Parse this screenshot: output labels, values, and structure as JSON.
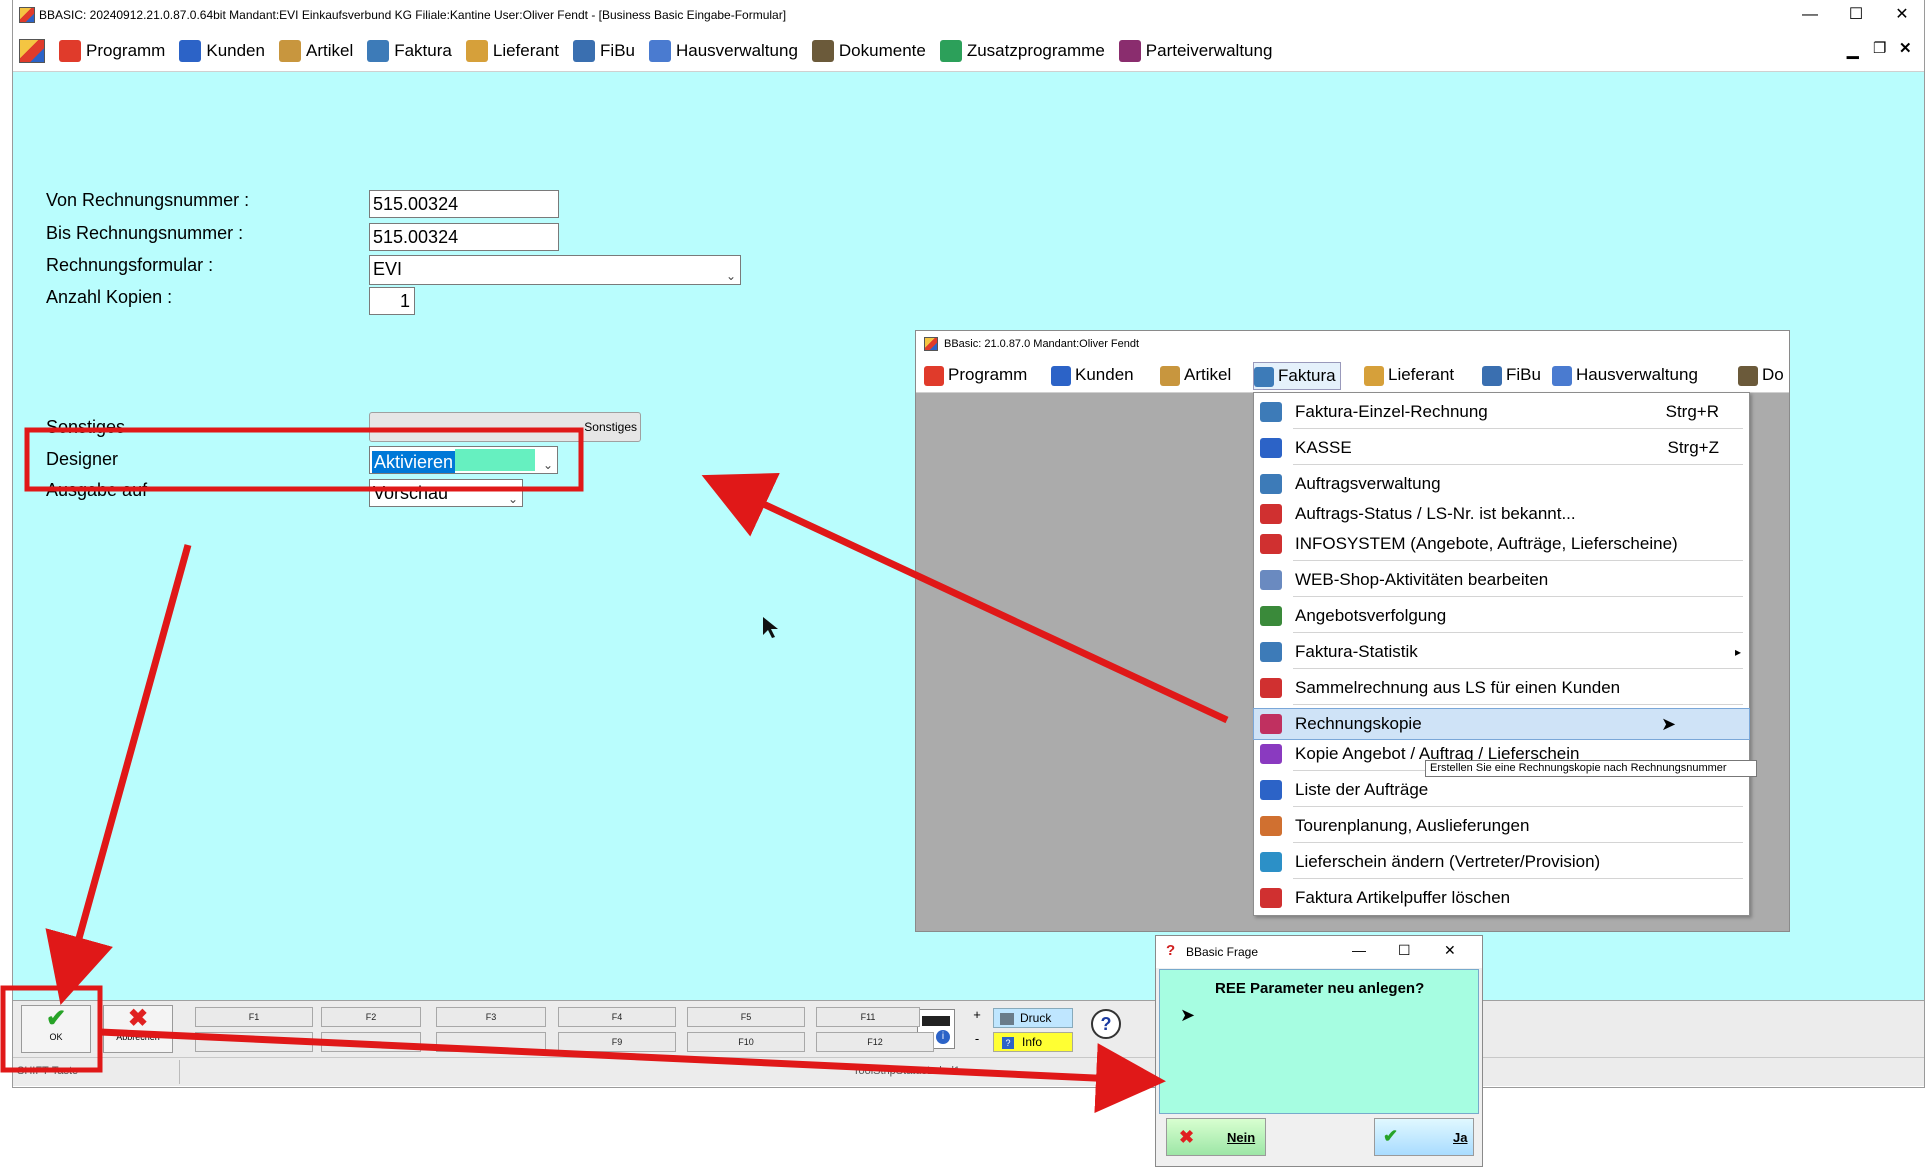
{
  "main": {
    "title": "BBASIC: 20240912.21.0.87.0.64bit Mandant:EVI Einkaufsverbund KG Filiale:Kantine User:Oliver Fendt - [Business Basic Eingabe-Formular]",
    "window_controls": {
      "minimize": "—",
      "maximize": "☐",
      "close": "✕"
    },
    "mdi_controls": {
      "minimize": "▁",
      "restore": "❐",
      "close": "✕"
    },
    "menu": [
      {
        "label": "Programm",
        "icon": "program-icon",
        "color": "#e03b2b"
      },
      {
        "label": "Kunden",
        "icon": "customers-icon",
        "color": "#2c63c7"
      },
      {
        "label": "Artikel",
        "icon": "article-box-icon",
        "color": "#c8963e"
      },
      {
        "label": "Faktura",
        "icon": "faktura-icon",
        "color": "#3d7bb8"
      },
      {
        "label": "Lieferant",
        "icon": "supplier-icon",
        "color": "#d6a03a"
      },
      {
        "label": "FiBu",
        "icon": "fibu-icon",
        "color": "#3a6fb0"
      },
      {
        "label": "Hausverwaltung",
        "icon": "house-icon",
        "color": "#4a7bd0"
      },
      {
        "label": "Dokumente",
        "icon": "documents-icon",
        "color": "#6b5a3a"
      },
      {
        "label": "Zusatzprogramme",
        "icon": "addons-icon",
        "color": "#2ca05a"
      },
      {
        "label": "Parteiverwaltung",
        "icon": "party-icon",
        "color": "#8a2d6e"
      }
    ]
  },
  "form": {
    "von_label": "Von Rechnungsnummer :",
    "von_value": "515.00324",
    "bis_label": "Bis Rechnungsnummer :",
    "bis_value": "515.00324",
    "formular_label": "Rechnungsformular :",
    "formular_value": "EVI",
    "kopien_label": "Anzahl Kopien :",
    "kopien_value": "1",
    "sonstiges_label": "Sonstiges",
    "sonstiges_button": "Sonstiges",
    "designer_label": "Designer",
    "designer_value": "Aktivieren",
    "ausgabe_label": "Ausgabe auf",
    "ausgabe_value": "Vorschau"
  },
  "toolbar": {
    "ok_label": "OK",
    "cancel_label": "Abbrechen",
    "fkeys_top": [
      "F1",
      "F2",
      "F3",
      "F4",
      "F5",
      "F11"
    ],
    "fkeys_bottom": [
      "F9",
      "F10",
      "F12"
    ],
    "plus": "+",
    "minus": "-",
    "druck_label": "Druck",
    "info_label": "Info",
    "help_icon": "?"
  },
  "status": {
    "left": "SHIFT-Taste",
    "center": "ToolStripStatusLabel1"
  },
  "inset": {
    "title": "BBasic: 21.0.87.0 Mandant:Oliver Fendt",
    "menu": [
      "Programm",
      "Kunden",
      "Artikel",
      "Faktura",
      "Lieferant",
      "FiBu",
      "Hausverwaltung",
      "Do"
    ],
    "dropdown": [
      {
        "label": "Faktura-Einzel-Rechnung",
        "shortcut": "Strg+R",
        "icon": "invoice-icon",
        "color": "#3d7bb8"
      },
      {
        "label": "KASSE",
        "shortcut": "Strg+Z",
        "icon": "cash-register-icon",
        "color": "#2c63c7"
      },
      {
        "label": "Auftragsverwaltung",
        "shortcut": "",
        "icon": "orders-icon",
        "color": "#3d7bb8"
      },
      {
        "label": "Auftrags-Status / LS-Nr. ist bekannt...",
        "shortcut": "",
        "icon": "order-status-icon",
        "color": "#d03030"
      },
      {
        "label": "INFOSYSTEM (Angebote, Aufträge, Lieferscheine)",
        "shortcut": "",
        "icon": "infosystem-icon",
        "color": "#d03030"
      },
      {
        "label": "WEB-Shop-Aktivitäten bearbeiten",
        "shortcut": "",
        "icon": "webshop-icon",
        "color": "#6a8ac0"
      },
      {
        "label": "Angebotsverfolgung",
        "shortcut": "",
        "icon": "offer-tracking-icon",
        "color": "#3a8a3a"
      },
      {
        "label": "Faktura-Statistik",
        "shortcut": "▸",
        "icon": "statistics-icon",
        "color": "#3d7bb8"
      },
      {
        "label": "Sammelrechnung aus LS für einen Kunden",
        "shortcut": "",
        "icon": "collective-invoice-icon",
        "color": "#d03030"
      },
      {
        "label": "Rechnungskopie",
        "shortcut": "",
        "icon": "invoice-copy-icon",
        "color": "#c03060"
      },
      {
        "label": "Kopie Angebot / Auftrag / Lieferschein",
        "shortcut": "",
        "icon": "copy-document-icon",
        "color": "#8a3ac0"
      },
      {
        "label": "Liste der Aufträge",
        "shortcut": "",
        "icon": "list-icon",
        "color": "#2c63c7"
      },
      {
        "label": "Tourenplanung, Auslieferungen",
        "shortcut": "",
        "icon": "route-planning-icon",
        "color": "#d07030"
      },
      {
        "label": "Lieferschein ändern (Vertreter/Provision)",
        "shortcut": "",
        "icon": "edit-delivery-icon",
        "color": "#2c90c7"
      },
      {
        "label": "Faktura Artikelpuffer löschen",
        "shortcut": "",
        "icon": "layers-delete-icon",
        "color": "#d03030"
      }
    ],
    "tooltip": "Erstellen Sie eine Rechnungskopie nach Rechnungsnummer"
  },
  "dialog": {
    "title": "BBasic Frage",
    "question": "REE Parameter neu anlegen?",
    "no_label": "Nein",
    "yes_label": "Ja",
    "controls": {
      "minimize": "—",
      "maximize": "☐",
      "close": "✕"
    }
  },
  "colors": {
    "content_bg": "#b9fdfd",
    "dialog_bg": "#a6fde1",
    "highlight_red": "#e01818",
    "selection_blue": "#cfe3f7"
  }
}
